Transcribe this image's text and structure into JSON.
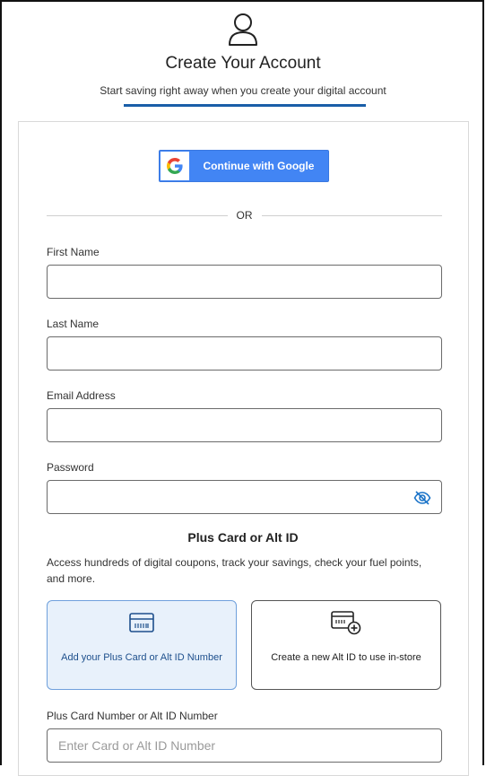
{
  "header": {
    "icon": "user-outline-icon",
    "title": "Create Your Account",
    "subtitle": "Start saving right away when you create your digital account"
  },
  "google": {
    "label": "Continue with Google",
    "icon": "google-g-icon",
    "color": "#4285f4"
  },
  "divider": {
    "text": "OR"
  },
  "form": {
    "first_name": {
      "label": "First Name",
      "value": ""
    },
    "last_name": {
      "label": "Last Name",
      "value": ""
    },
    "email": {
      "label": "Email Address",
      "value": ""
    },
    "password": {
      "label": "Password",
      "value": "",
      "toggle_icon": "eye-off-icon"
    }
  },
  "plus_card": {
    "title": "Plus Card or Alt ID",
    "description": "Access hundreds of digital coupons, track your savings, check your fuel points, and more.",
    "options": [
      {
        "label": "Add your Plus Card or Alt ID Number",
        "icon": "card-icon",
        "selected": true
      },
      {
        "label": "Create a new Alt ID to use in-store",
        "icon": "card-add-icon",
        "selected": false
      }
    ],
    "number_field": {
      "label": "Plus Card Number or Alt ID Number",
      "placeholder": "Enter Card or Alt ID Number",
      "value": ""
    }
  },
  "colors": {
    "accent": "#1a5ea8",
    "selected_tile_bg": "#e8f1fb"
  }
}
